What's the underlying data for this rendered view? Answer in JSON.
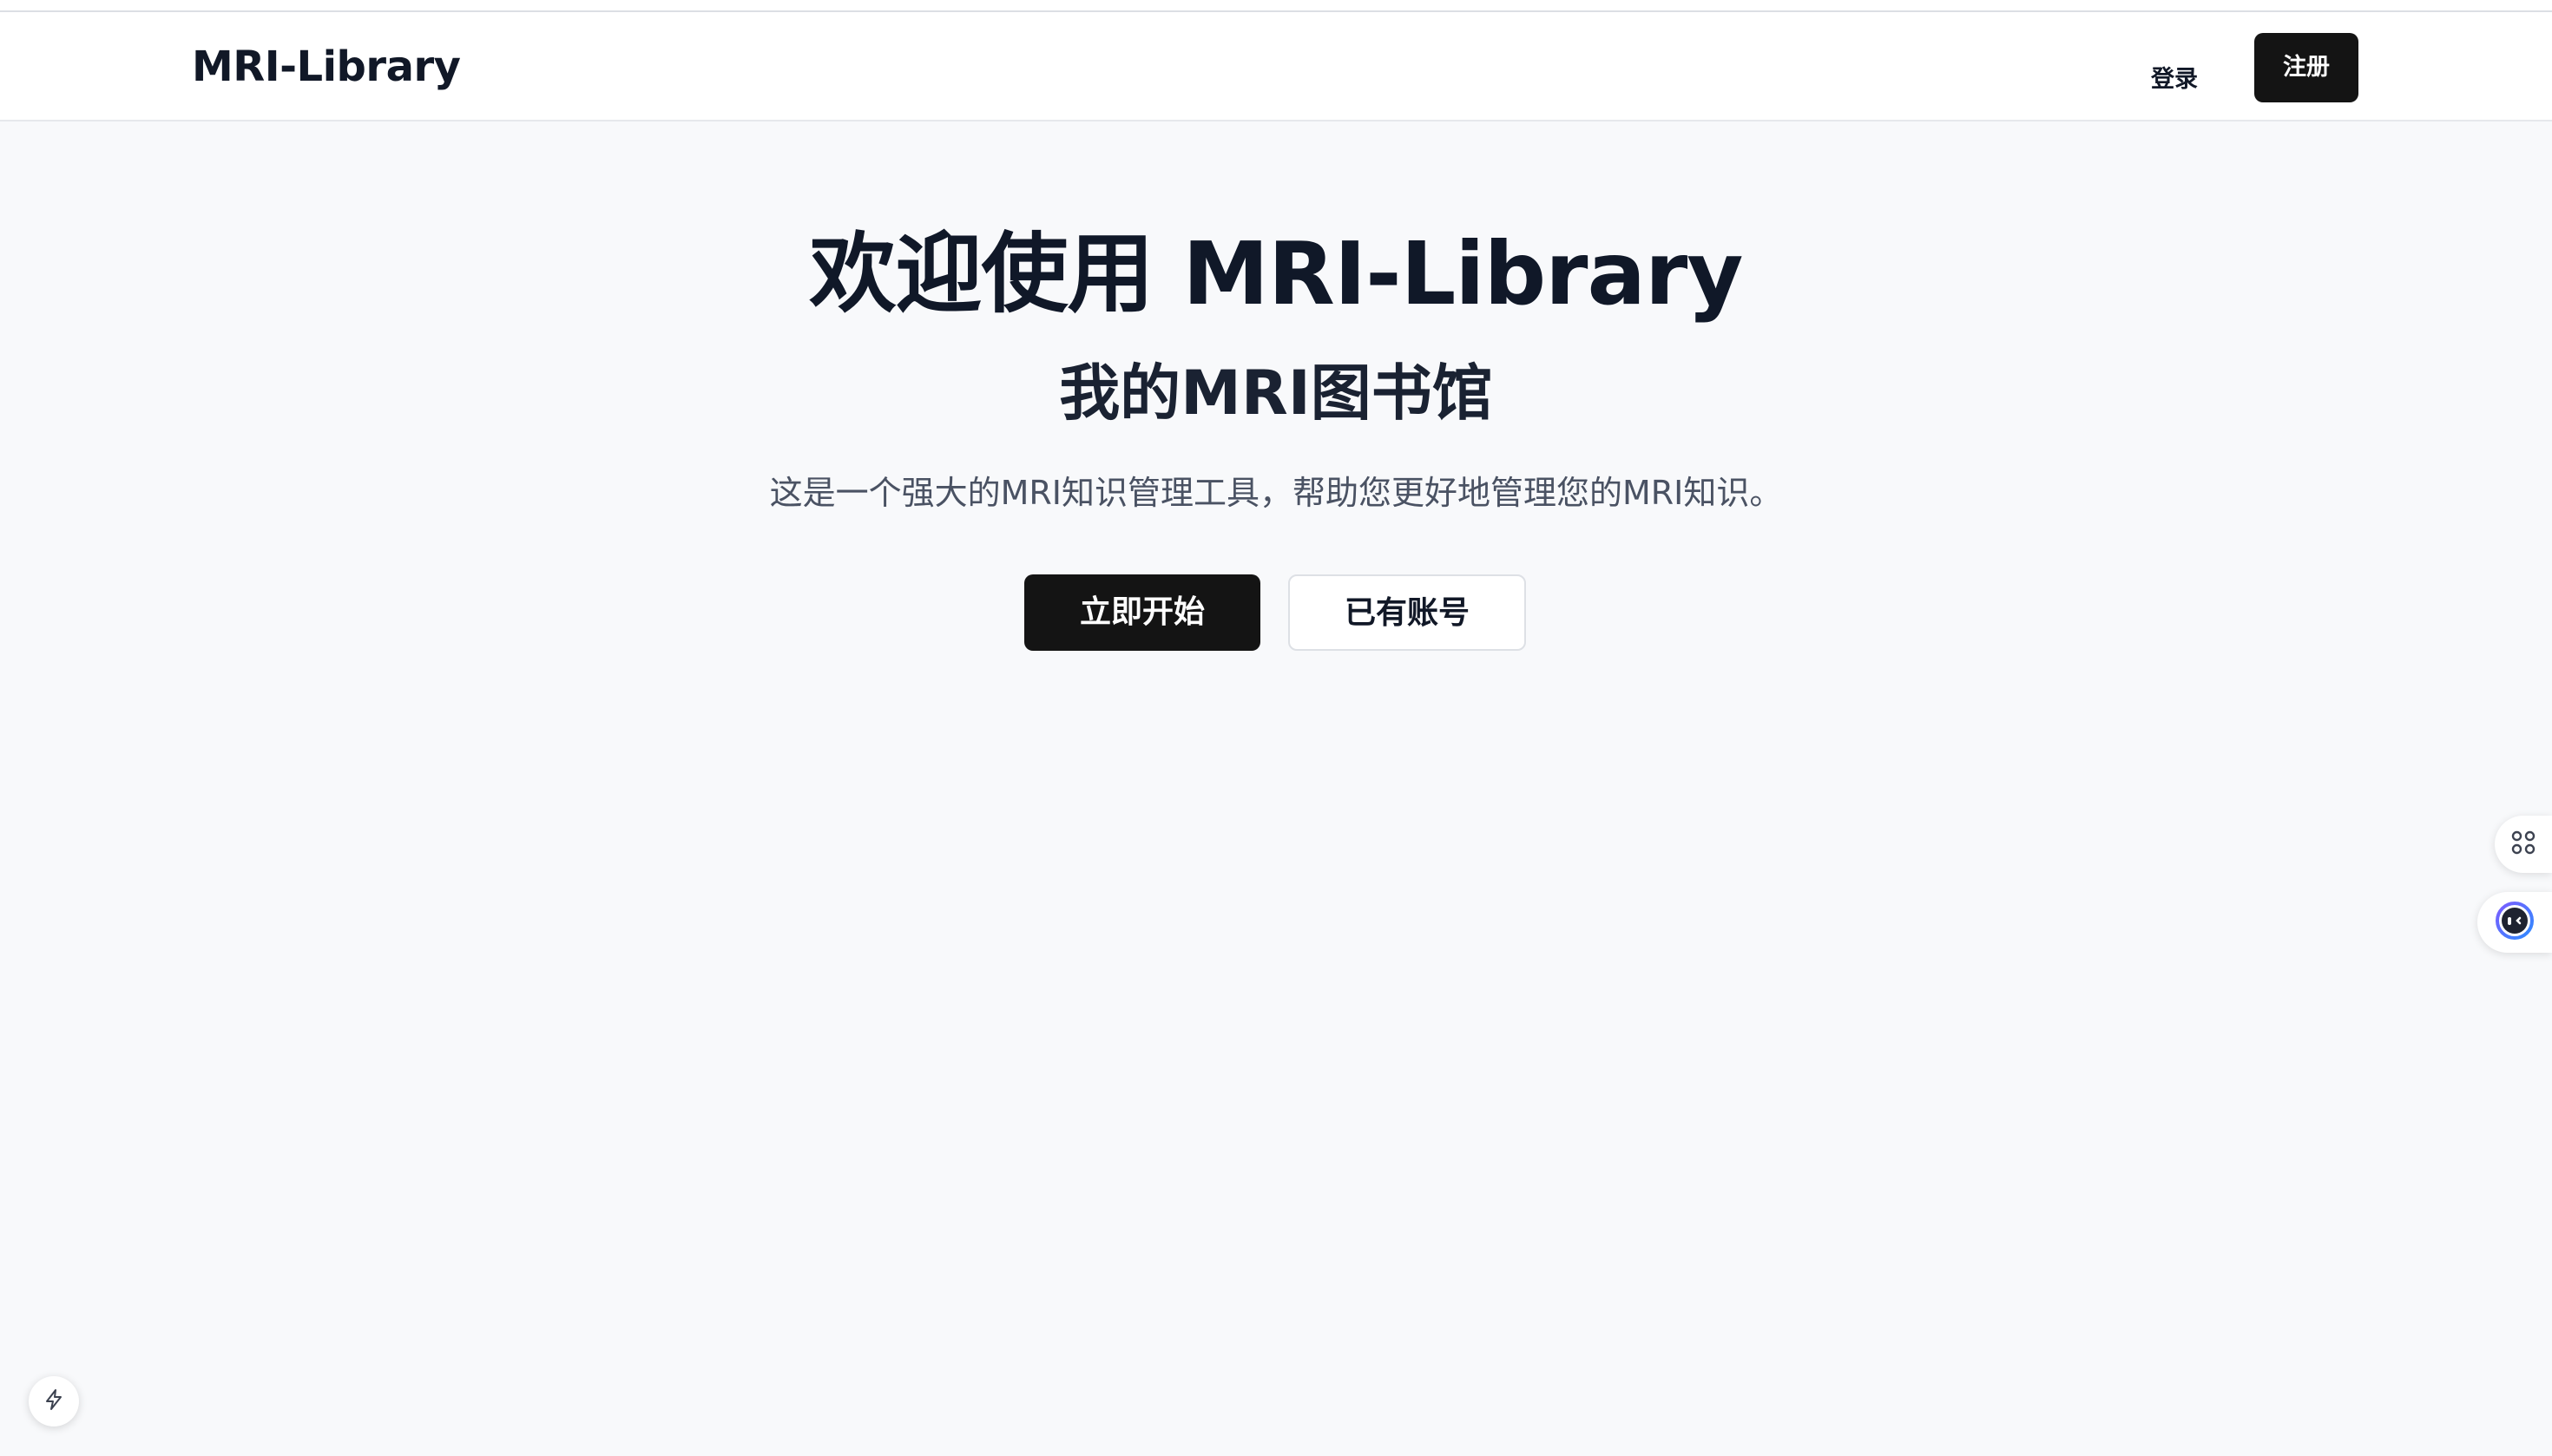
{
  "navbar": {
    "brand": "MRI-Library",
    "login_label": "登录",
    "register_label": "注册"
  },
  "hero": {
    "title": "欢迎使用 MRI-Library",
    "subtitle": "我的MRI图书馆",
    "description": "这是一个强大的MRI知识管理工具，帮助您更好地管理您的MRI知识。",
    "primary_button": "立即开始",
    "secondary_button": "已有账号"
  },
  "floating": {
    "side_top_icon": "command-icon",
    "side_bottom_icon": "assistant-bot-icon",
    "bottom_left_icon": "lightning-icon",
    "accent_colors": [
      "#7b5cff",
      "#2f8bff"
    ]
  },
  "colors": {
    "primary_button_bg": "#141414",
    "page_bg": "#f8f9fb",
    "heading_text": "#101828",
    "body_text": "#4a5263"
  }
}
